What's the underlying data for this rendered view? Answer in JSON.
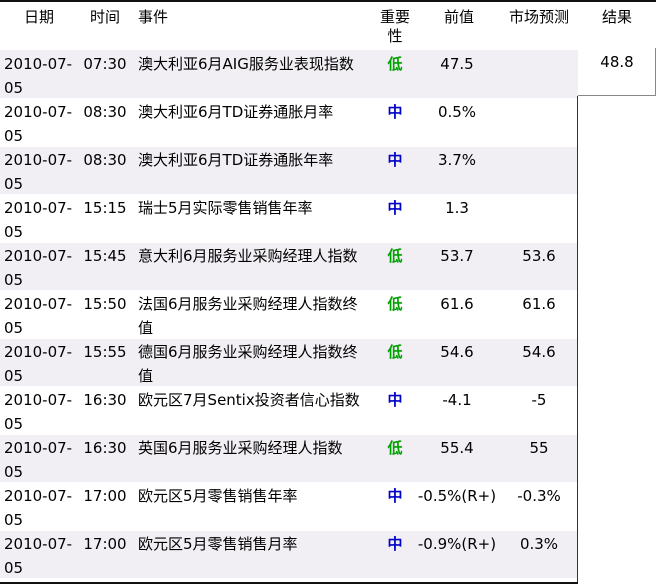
{
  "headers": {
    "date": "日期",
    "time": "时间",
    "event": "事件",
    "importance": "重要性",
    "previous": "前值",
    "forecast": "市场预测",
    "result": "结果"
  },
  "colors": {
    "low": "#00a000",
    "mid": "#0000c8",
    "row_shade": "#f1eff4"
  },
  "rows": [
    {
      "date": "2010-07-05",
      "time": "07:30",
      "event": "澳大利亚6月AIG服务业表现指数",
      "importance": "低",
      "level": "low",
      "previous": "47.5",
      "forecast": "",
      "result": "48.8"
    },
    {
      "date": "2010-07-05",
      "time": "08:30",
      "event": "澳大利亚6月TD证券通胀月率",
      "importance": "中",
      "level": "mid",
      "previous": "0.5%",
      "forecast": "",
      "result": ""
    },
    {
      "date": "2010-07-05",
      "time": "08:30",
      "event": "澳大利亚6月TD证券通胀年率",
      "importance": "中",
      "level": "mid",
      "previous": "3.7%",
      "forecast": "",
      "result": ""
    },
    {
      "date": "2010-07-05",
      "time": "15:15",
      "event": "瑞士5月实际零售销售年率",
      "importance": "中",
      "level": "mid",
      "previous": "1.3",
      "forecast": "",
      "result": ""
    },
    {
      "date": "2010-07-05",
      "time": "15:45",
      "event": "意大利6月服务业采购经理人指数",
      "importance": "低",
      "level": "low",
      "previous": "53.7",
      "forecast": "53.6",
      "result": ""
    },
    {
      "date": "2010-07-05",
      "time": "15:50",
      "event": "法国6月服务业采购经理人指数终值",
      "importance": "低",
      "level": "low",
      "previous": "61.6",
      "forecast": "61.6",
      "result": ""
    },
    {
      "date": "2010-07-05",
      "time": "15:55",
      "event": "德国6月服务业采购经理人指数终值",
      "importance": "低",
      "level": "low",
      "previous": "54.6",
      "forecast": "54.6",
      "result": ""
    },
    {
      "date": "2010-07-05",
      "time": "16:30",
      "event": "欧元区7月Sentix投资者信心指数",
      "importance": "中",
      "level": "mid",
      "previous": "-4.1",
      "forecast": "-5",
      "result": ""
    },
    {
      "date": "2010-07-05",
      "time": "16:30",
      "event": "英国6月服务业采购经理人指数",
      "importance": "低",
      "level": "low",
      "previous": "55.4",
      "forecast": "55",
      "result": ""
    },
    {
      "date": "2010-07-05",
      "time": "17:00",
      "event": "欧元区5月零售销售年率",
      "importance": "中",
      "level": "mid",
      "previous": "-0.5%(R+)",
      "forecast": "-0.3%",
      "result": ""
    },
    {
      "date": "2010-07-05",
      "time": "17:00",
      "event": "欧元区5月零售销售月率",
      "importance": "中",
      "level": "mid",
      "previous": "-0.9%(R+)",
      "forecast": "0.3%",
      "result": ""
    }
  ]
}
